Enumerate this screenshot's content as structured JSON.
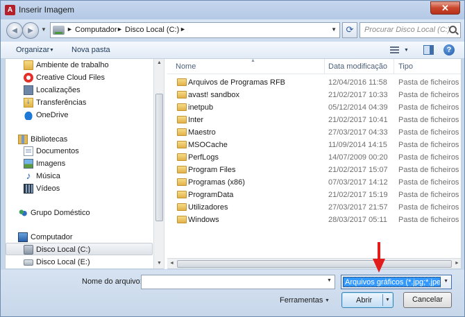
{
  "window": {
    "title": "Inserir Imagem",
    "app_icon_glyph": "A",
    "close_glyph": "✕"
  },
  "navigation": {
    "back_glyph": "◄",
    "forward_glyph": "►",
    "breadcrumbs": [
      "Computador",
      "Disco Local (C:)"
    ],
    "refresh_glyph": "⟳",
    "search_placeholder": "Procurar Disco Local (C:)"
  },
  "toolbar": {
    "organize_label": "Organizar",
    "new_folder_label": "Nova pasta",
    "help_glyph": "?"
  },
  "sidebar": {
    "items": [
      {
        "label": "Ambiente de trabalho",
        "icon": "folder-icon"
      },
      {
        "label": "Creative Cloud Files",
        "icon": "creative-cloud-icon"
      },
      {
        "label": "Localizações",
        "icon": "locations-icon"
      },
      {
        "label": "Transferências",
        "icon": "downloads-icon"
      },
      {
        "label": "OneDrive",
        "icon": "onedrive-icon"
      },
      {
        "label": "Bibliotecas",
        "icon": "libraries-icon"
      },
      {
        "label": "Documentos",
        "icon": "documents-icon"
      },
      {
        "label": "Imagens",
        "icon": "pictures-icon"
      },
      {
        "label": "Música",
        "icon": "music-icon"
      },
      {
        "label": "Vídeos",
        "icon": "videos-icon"
      },
      {
        "label": "Grupo Doméstico",
        "icon": "homegroup-icon"
      },
      {
        "label": "Computador",
        "icon": "computer-icon"
      },
      {
        "label": "Disco Local (C:)",
        "icon": "drive-icon",
        "selected": true
      },
      {
        "label": "Disco Local (E:)",
        "icon": "drive-icon"
      }
    ]
  },
  "file_list": {
    "columns": [
      "Nome",
      "Data modificação",
      "Tipo"
    ],
    "rows": [
      {
        "name": "Arquivos de Programas RFB",
        "date": "12/04/2016 11:58",
        "type": "Pasta de ficheiros"
      },
      {
        "name": "avast! sandbox",
        "date": "21/02/2017 10:33",
        "type": "Pasta de ficheiros"
      },
      {
        "name": "inetpub",
        "date": "05/12/2014 04:39",
        "type": "Pasta de ficheiros"
      },
      {
        "name": "Inter",
        "date": "21/02/2017 10:41",
        "type": "Pasta de ficheiros"
      },
      {
        "name": "Maestro",
        "date": "27/03/2017 04:33",
        "type": "Pasta de ficheiros"
      },
      {
        "name": "MSOCache",
        "date": "11/09/2014 14:15",
        "type": "Pasta de ficheiros"
      },
      {
        "name": "PerfLogs",
        "date": "14/07/2009 00:20",
        "type": "Pasta de ficheiros"
      },
      {
        "name": "Program Files",
        "date": "21/02/2017 15:07",
        "type": "Pasta de ficheiros"
      },
      {
        "name": "Programas (x86)",
        "date": "07/03/2017 14:12",
        "type": "Pasta de ficheiros"
      },
      {
        "name": "ProgramData",
        "date": "21/02/2017 15:19",
        "type": "Pasta de ficheiros"
      },
      {
        "name": "Utilizadores",
        "date": "27/03/2017 21:57",
        "type": "Pasta de ficheiros"
      },
      {
        "name": "Windows",
        "date": "28/03/2017 05:11",
        "type": "Pasta de ficheiros"
      }
    ]
  },
  "footer": {
    "filename_label": "Nome do arquivo:",
    "filename_value": "",
    "filter_value": "Arquivos gráficos (*.jpg;*.jpeg;",
    "tools_label": "Ferramentas",
    "open_label": "Abrir",
    "cancel_label": "Cancelar"
  },
  "colors": {
    "annotation_arrow": "#e21b1b",
    "selection": "#3399ff",
    "folder": "#e1b24a"
  }
}
